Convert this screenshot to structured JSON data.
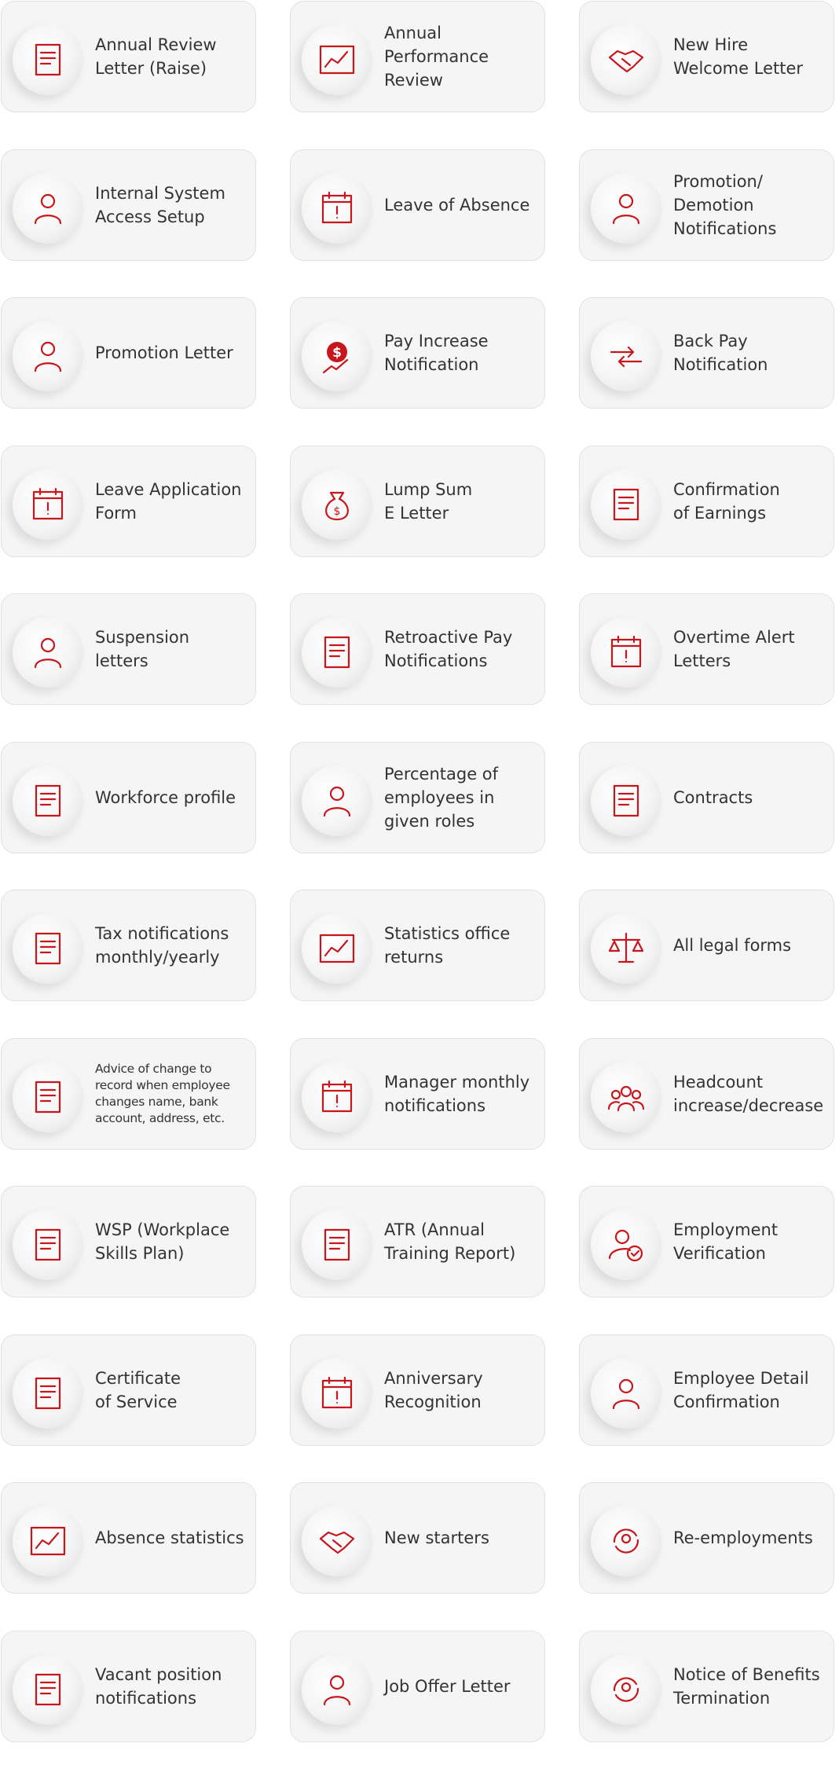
{
  "accent_color": "#c8161d",
  "cards": [
    {
      "label": "Annual Review\nLetter (Raise)",
      "icon": "salary-raise-icon"
    },
    {
      "label": "Annual\nPerformance\nReview",
      "icon": "performance-chart-icon"
    },
    {
      "label": "New Hire\nWelcome Letter",
      "icon": "handshake-icon"
    },
    {
      "label": "Internal System\nAccess Setup",
      "icon": "user-access-icon"
    },
    {
      "label": "Leave of Absence",
      "icon": "calendar-alert-icon"
    },
    {
      "label": "Promotion/\nDemotion\nNotifications",
      "icon": "promotion-demotion-icon"
    },
    {
      "label": "Promotion Letter",
      "icon": "promotion-user-icon"
    },
    {
      "label": "Pay Increase\nNotification",
      "icon": "dollar-increase-icon"
    },
    {
      "label": "Back Pay\nNotification",
      "icon": "back-pay-arrows-icon"
    },
    {
      "label": "Leave Application\nForm",
      "icon": "leave-form-icon"
    },
    {
      "label": "Lump Sum\nE Letter",
      "icon": "money-bag-icon"
    },
    {
      "label": "Confirmation\nof Earnings",
      "icon": "earnings-cheque-icon"
    },
    {
      "label": "Suspension\nletters",
      "icon": "user-outline-dashed-icon"
    },
    {
      "label": "Retroactive Pay\nNotifications",
      "icon": "money-hourglass-icon"
    },
    {
      "label": "Overtime Alert\nLetters",
      "icon": "clock-calendar-icon"
    },
    {
      "label": "Workforce profile",
      "icon": "profile-book-icon"
    },
    {
      "label": "Percentage of\nemployees in\ngiven roles",
      "icon": "user-percent-icon"
    },
    {
      "label": "Contracts",
      "icon": "contract-user-icon"
    },
    {
      "label": "Tax notifications\nmonthly/yearly",
      "icon": "tax-alert-icon"
    },
    {
      "label": "Statistics office\nreturns",
      "icon": "statistics-board-icon"
    },
    {
      "label": "All legal forms",
      "icon": "scales-icon"
    },
    {
      "label": "Advice of change to\nrecord when employee\nchanges name, bank\naccount, address, etc.",
      "icon": "change-info-icon"
    },
    {
      "label": "Manager monthly\nnotifications",
      "icon": "calendar-bell-icon"
    },
    {
      "label": "Headcount\nincrease/decrease",
      "icon": "group-users-icon"
    },
    {
      "label": "WSP (Workplace\nSkills Plan)",
      "icon": "clipboard-skills-icon"
    },
    {
      "label": "ATR (Annual\nTraining Report)",
      "icon": "atr-document-icon"
    },
    {
      "label": "Employment\nVerification",
      "icon": "user-check-icon"
    },
    {
      "label": "Certificate\nof Service",
      "icon": "certificate-icon"
    },
    {
      "label": "Anniversary\nRecognition",
      "icon": "calendar-handshake-icon"
    },
    {
      "label": "Employee Detail\nConfirmation",
      "icon": "id-badge-icon"
    },
    {
      "label": "Absence statistics",
      "icon": "line-chart-icon"
    },
    {
      "label": "New starters",
      "icon": "handshake-icon"
    },
    {
      "label": "Re-employments",
      "icon": "user-cycle-icon"
    },
    {
      "label": "Vacant position\nnotifications",
      "icon": "vacancy-bell-icon"
    },
    {
      "label": "Job Offer Letter",
      "icon": "hand-user-icon"
    },
    {
      "label": "Notice of Benefits\nTermination",
      "icon": "benefit-termination-icon"
    }
  ]
}
